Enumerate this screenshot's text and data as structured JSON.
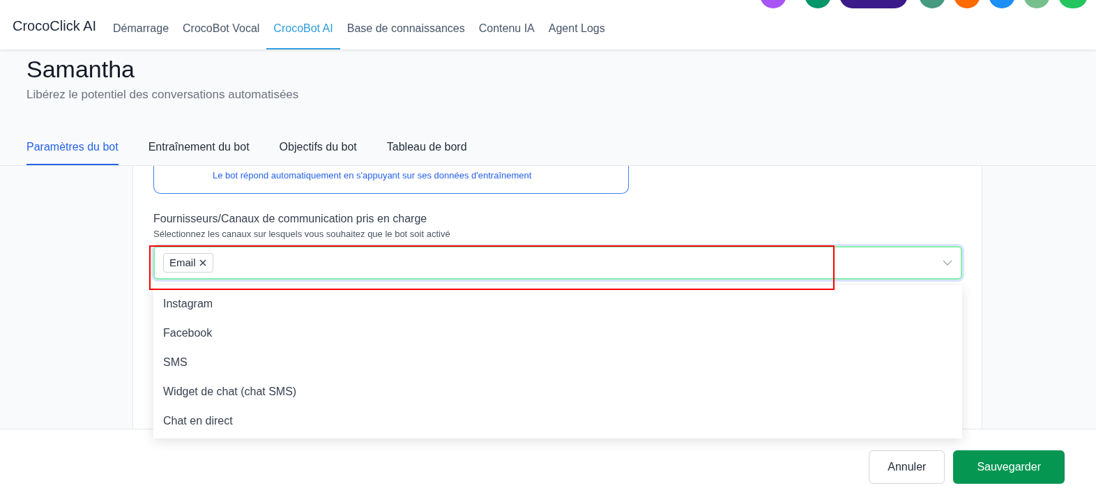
{
  "brand": "CrocoClick AI",
  "nav": [
    {
      "label": "Démarrage",
      "selected": false
    },
    {
      "label": "CrocoBot Vocal",
      "selected": false
    },
    {
      "label": "CrocoBot AI",
      "selected": true
    },
    {
      "label": "Base de connaissances",
      "selected": false
    },
    {
      "label": "Contenu IA",
      "selected": false
    },
    {
      "label": "Agent Logs",
      "selected": false
    }
  ],
  "title": "Samantha",
  "subtitle": "Libérez le potentiel des conversations automatisées",
  "tabs": [
    {
      "label": "Paramètres du bot",
      "selected": true
    },
    {
      "label": "Entraînement du bot",
      "selected": false
    },
    {
      "label": "Objectifs du bot",
      "selected": false
    },
    {
      "label": "Tableau de bord",
      "selected": false
    }
  ],
  "mode_card": {
    "description": "Le bot répond automatiquement en s'appuyant sur ses données d'entraînement"
  },
  "channels": {
    "label": "Fournisseurs/Canaux de communication pris en charge",
    "hint": "Sélectionnez les canaux sur lesquels vous souhaitez que le bot soit activé",
    "tags": [
      "Email"
    ],
    "options": [
      "Instagram",
      "Facebook",
      "SMS",
      "Widget de chat (chat SMS)",
      "Chat en direct"
    ]
  },
  "buttons": {
    "cancel": "Annuler",
    "save": "Sauvegarder"
  }
}
